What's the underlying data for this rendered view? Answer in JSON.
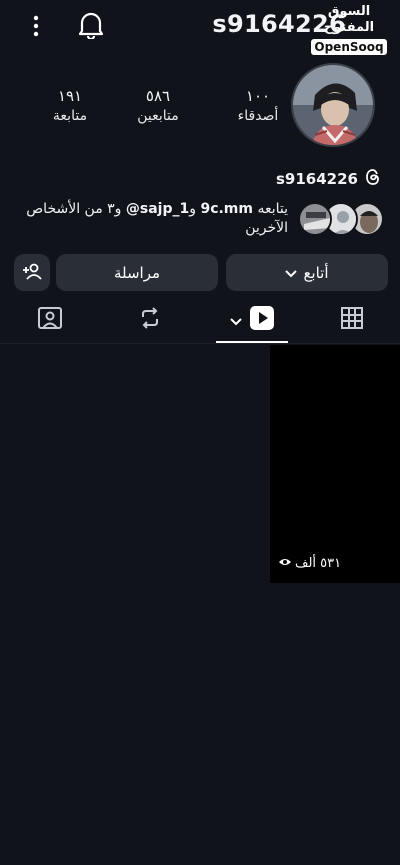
{
  "header": {
    "username": "s9164226",
    "watermark_arabic": "السوق المفتوح",
    "watermark_brand": "OpenSooq"
  },
  "stats": [
    {
      "value": "١٠٠",
      "label": "أصدقاء"
    },
    {
      "value": "٥٨٦",
      "label": "متابعين"
    },
    {
      "value": "١٩١",
      "label": "متابعة"
    }
  ],
  "profile": {
    "handle": "s9164226"
  },
  "followed_by": {
    "prefix": "يتابعه",
    "user1": "9c.mm",
    "joiner": "و",
    "user2": "sajp_1",
    "suffix": "و٣ من الأشخاص الآخرين"
  },
  "actions": {
    "follow_label": "أتابع",
    "message_label": "مراسلة"
  },
  "tabs": [
    {
      "icon": "grid-icon"
    },
    {
      "icon": "reels-play-icon"
    },
    {
      "icon": "repost-icon"
    },
    {
      "icon": "tagged-person-icon"
    }
  ],
  "posts": [
    {
      "views": "٥٣١ ألف"
    }
  ],
  "colors": {
    "background": "#10131a",
    "button": "#2a2e36",
    "text": "#f1f3f6"
  }
}
